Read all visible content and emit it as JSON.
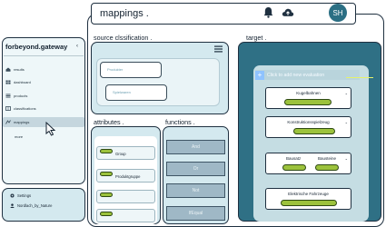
{
  "header": {
    "title": "mappings .",
    "avatar_initials": "SH"
  },
  "sidebar": {
    "brand": "forbeyond.gateway",
    "items": [
      {
        "label": "results"
      },
      {
        "label": "dashboard"
      },
      {
        "label": "products"
      },
      {
        "label": "classifications"
      },
      {
        "label": "mappings"
      },
      {
        "label": "more"
      }
    ],
    "footer": {
      "settings": "Settings",
      "user": "Nordlach_by_Nature"
    }
  },
  "source": {
    "heading": "source clssification .",
    "field1_placeholder": "Produkter",
    "field2_placeholder": "Spielwaren"
  },
  "attributes": {
    "heading": "attributes .",
    "items": [
      "Group",
      "Produktgruppe",
      "",
      ""
    ]
  },
  "functions": {
    "heading": "functions .",
    "items": [
      "And",
      "Or",
      "Not",
      "IfEqual"
    ]
  },
  "target": {
    "heading": "target .",
    "add_label": "Click to add new evaluation",
    "cards": [
      {
        "title": "Kugelbahnen"
      },
      {
        "title": "Konstruktionsspielzeug"
      },
      {
        "title_left": "Bausatz",
        "title_right": "Bausteine"
      },
      {
        "title": "Elektrische Fahrzeuge"
      }
    ]
  },
  "colors": {
    "accent_green": "#9cc23c",
    "target_blue": "#2f7085",
    "panel_bg": "#d4e9ef"
  }
}
